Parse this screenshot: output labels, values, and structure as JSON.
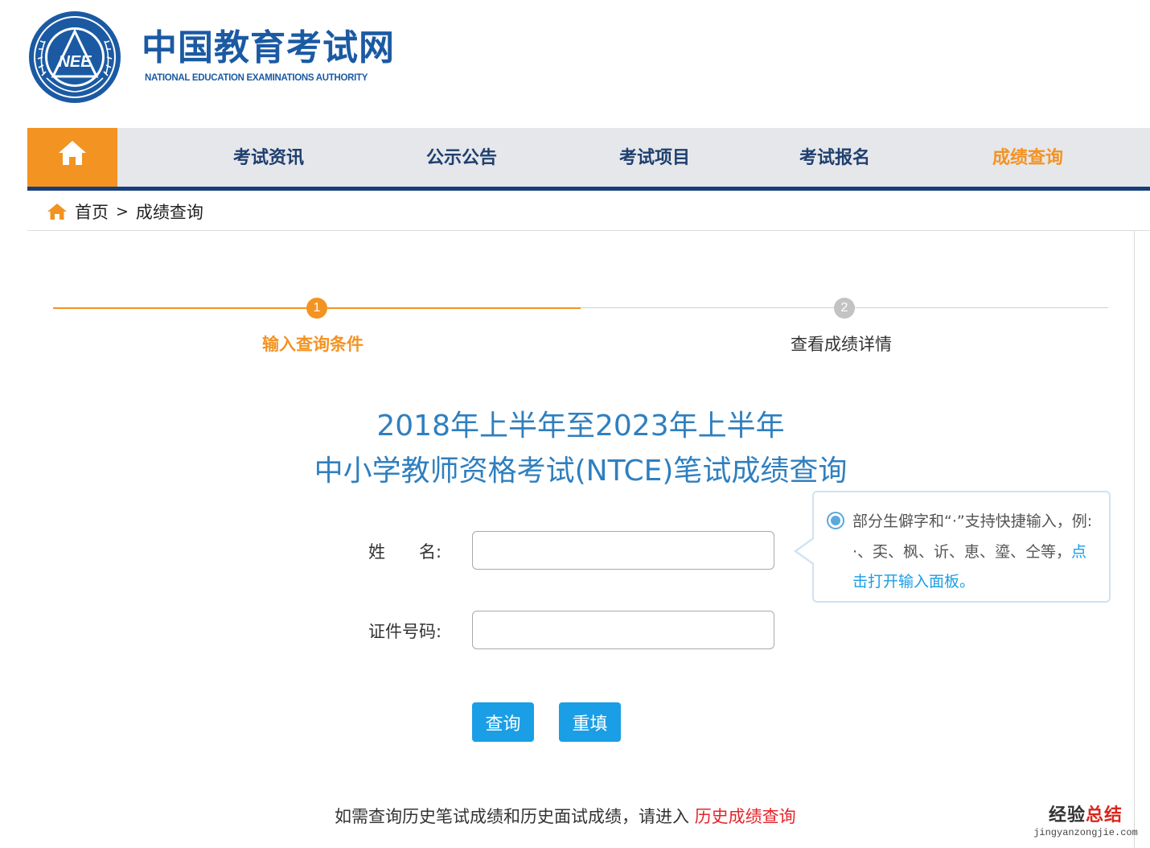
{
  "header": {
    "emblem_text": "NEE",
    "title_cn": "中国教育考试网",
    "title_en": "NATIONAL EDUCATION EXAMINATIONS AUTHORITY"
  },
  "nav": {
    "items": [
      {
        "label": "考试资讯"
      },
      {
        "label": "公示公告"
      },
      {
        "label": "考试项目"
      },
      {
        "label": "考试报名"
      },
      {
        "label": "成绩查询",
        "active": true
      }
    ]
  },
  "breadcrumb": {
    "home": "首页",
    "separator": ">",
    "current": "成绩查询"
  },
  "steps": [
    {
      "number": "1",
      "label": "输入查询条件",
      "active": true
    },
    {
      "number": "2",
      "label": "查看成绩详情",
      "active": false
    }
  ],
  "title": {
    "line1": "2018年上半年至2023年上半年",
    "line2": "中小学教师资格考试(NTCE)笔试成绩查询"
  },
  "form": {
    "name_label": "姓　　名:",
    "name_value": "",
    "id_label": "证件号码:",
    "id_value": "",
    "query_button": "查询",
    "reset_button": "重填"
  },
  "tooltip": {
    "text": "部分生僻字和“·”支持快捷输入，例: ·、奀、枫、䜣、恵、瑬、仝等，",
    "link": "点击打开输入面板。"
  },
  "footer": {
    "note": "如需查询历史笔试成绩和历史面试成绩，请进入 ",
    "link": "历史成绩查询"
  },
  "watermark": {
    "cn_part1": "经验",
    "cn_part2": "总结",
    "url": "jingyanzongjie.com"
  },
  "colors": {
    "brand_blue": "#1b5aa3",
    "accent_orange": "#f39322",
    "button_blue": "#1a9ee6",
    "title_blue": "#2f7fbf",
    "link_red": "#e8232b"
  }
}
